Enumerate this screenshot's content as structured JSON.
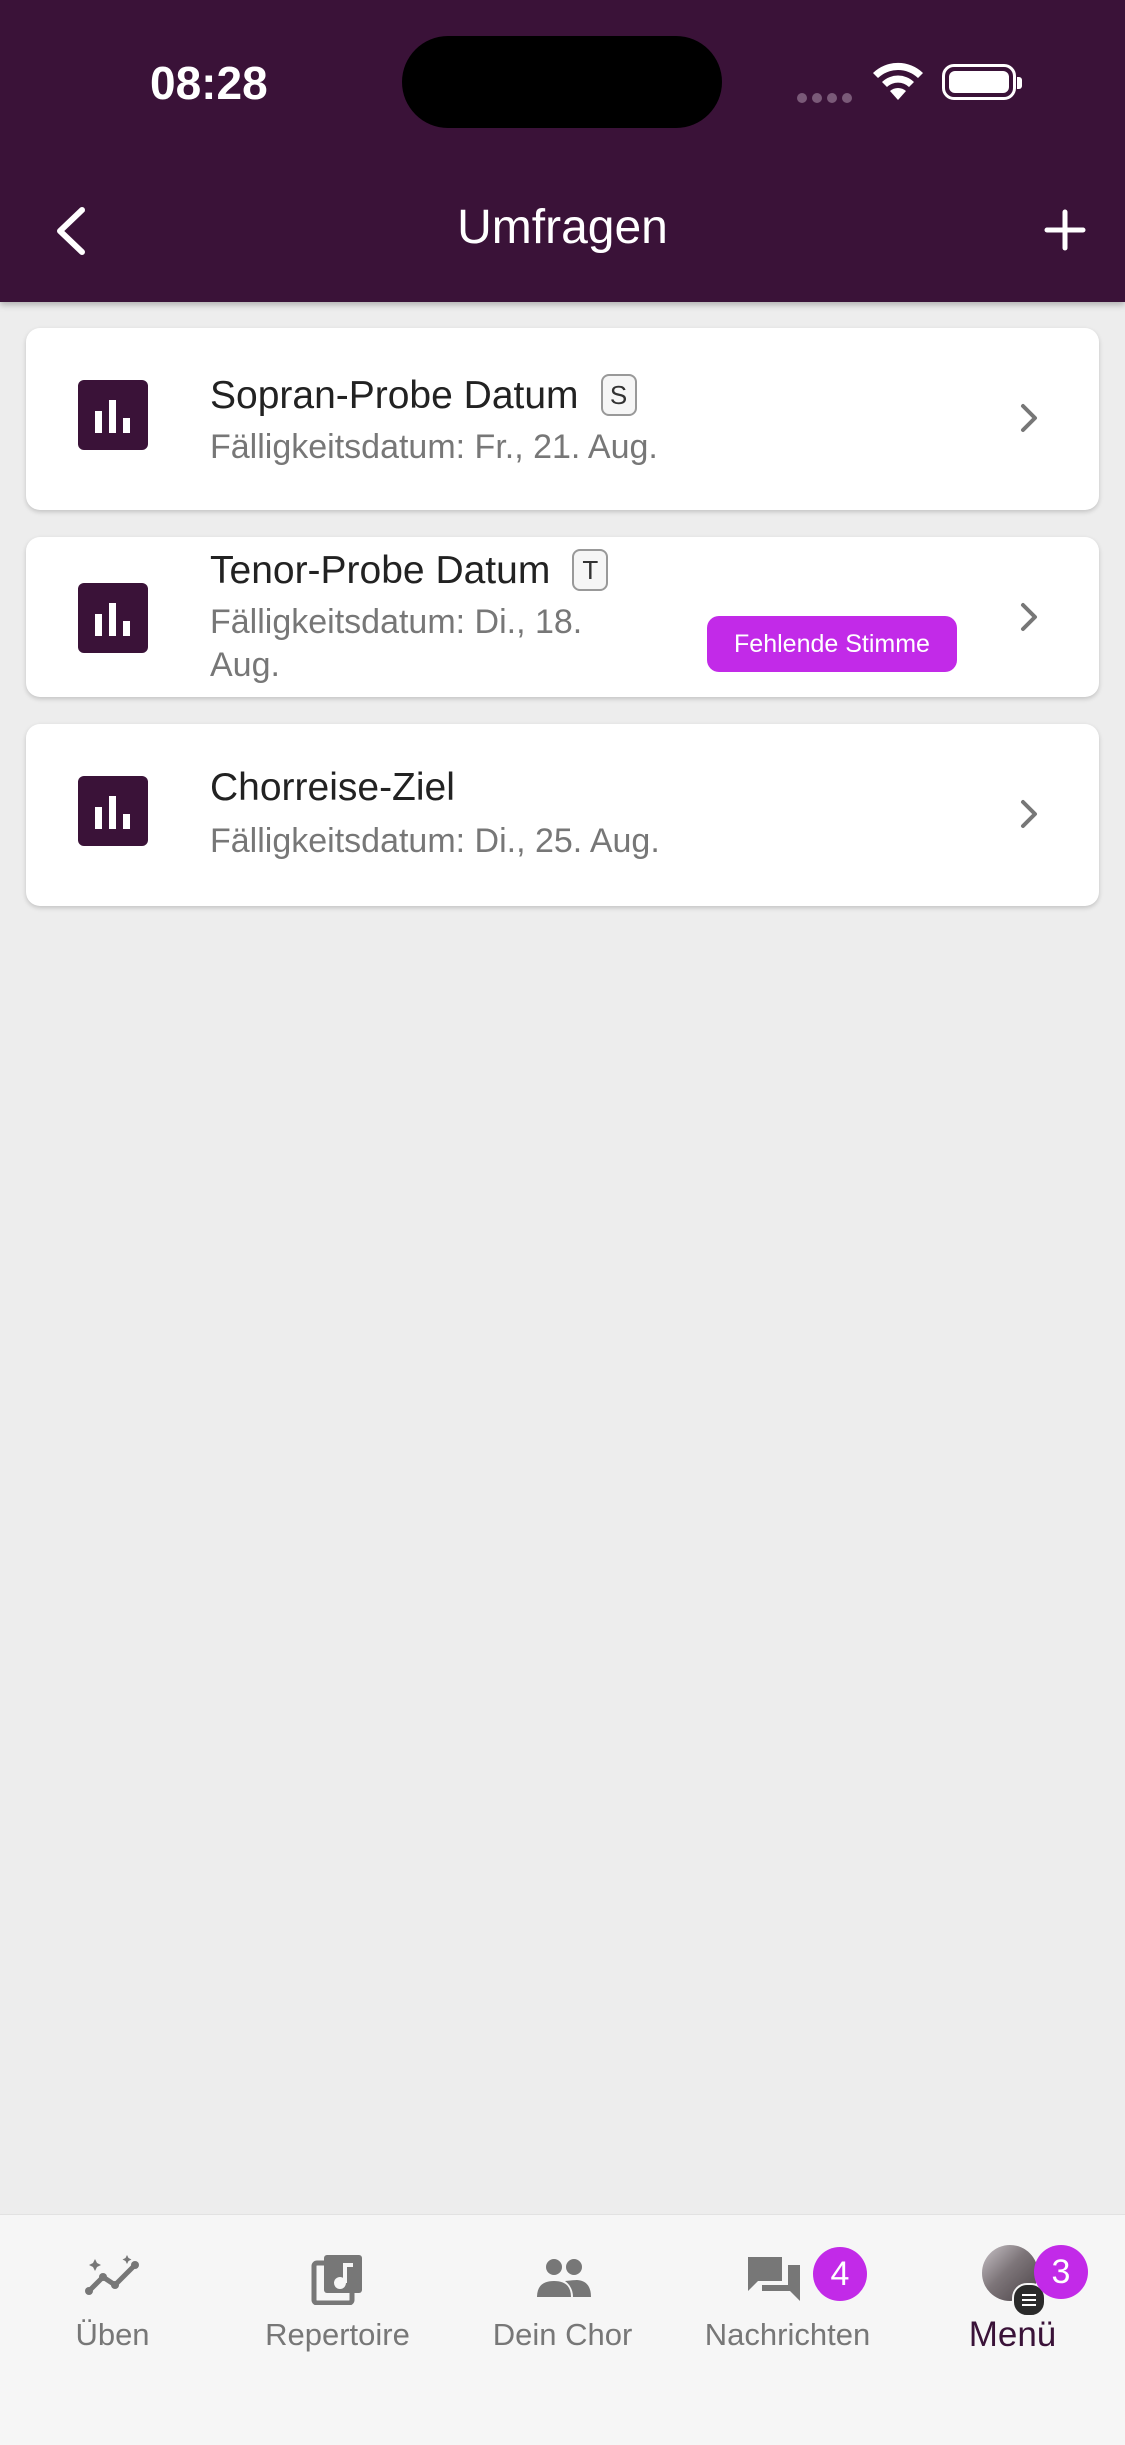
{
  "status_bar": {
    "time": "08:28"
  },
  "header": {
    "title": "Umfragen"
  },
  "polls": [
    {
      "title": "Sopran-Probe Datum",
      "voice": "S",
      "due": "Fälligkeitsdatum: Fr., 21. Aug.",
      "badge": ""
    },
    {
      "title": "Tenor-Probe Datum",
      "voice": "T",
      "due_line1": "Fälligkeitsdatum: Di., 18.",
      "due_line2": "Aug.",
      "badge": "Fehlende Stimme"
    },
    {
      "title": "Chorreise-Ziel",
      "voice": "",
      "due": "Fälligkeitsdatum: Di., 25. Aug.",
      "badge": ""
    }
  ],
  "bottom_nav": {
    "items": [
      {
        "label": "Üben",
        "icon": "practice-trend-icon"
      },
      {
        "label": "Repertoire",
        "icon": "music-library-icon"
      },
      {
        "label": "Dein Chor",
        "icon": "people-icon"
      },
      {
        "label": "Nachrichten",
        "icon": "chat-icon",
        "badge": "4"
      },
      {
        "label": "Menü",
        "icon": "avatar-menu-icon",
        "badge": "3",
        "active": true
      }
    ]
  },
  "colors": {
    "primary": "#3a1238",
    "accent": "#c22ae8",
    "background": "#ededed"
  }
}
